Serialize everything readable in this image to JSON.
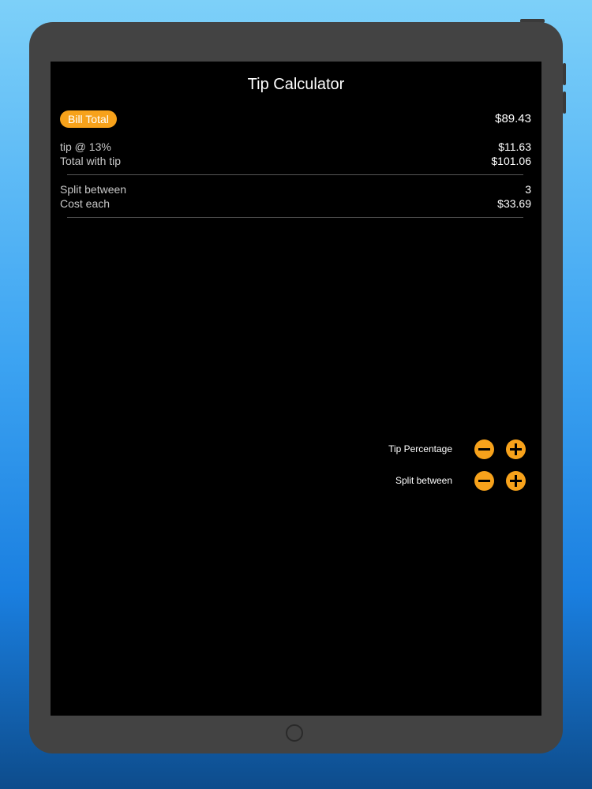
{
  "app": {
    "title": "Tip Calculator"
  },
  "bill": {
    "label": "Bill Total",
    "value": "$89.43"
  },
  "tip": {
    "label": "tip @ 13%",
    "value": "$11.63"
  },
  "total": {
    "label": "Total with tip",
    "value": "$101.06"
  },
  "split": {
    "label": "Split between",
    "value": "3"
  },
  "cost_each": {
    "label": "Cost each",
    "value": "$33.69"
  },
  "controls": {
    "tip_percentage_label": "Tip Percentage",
    "split_between_label": "Split between"
  },
  "colors": {
    "accent": "#f7a21b",
    "screen_background": "#000000"
  }
}
